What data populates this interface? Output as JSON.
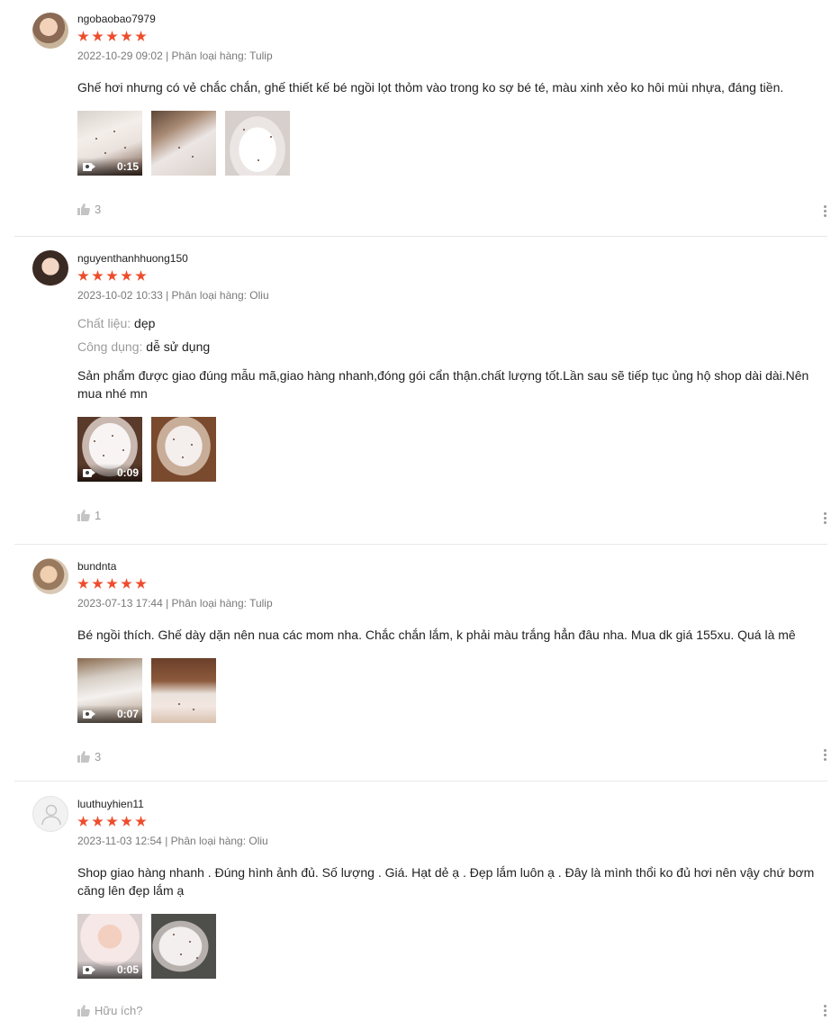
{
  "reviews": [
    {
      "username": "ngobaobao7979",
      "rating": 5,
      "date": "2022-10-29 09:02",
      "variant": "| Phân loại hàng: Tulip",
      "comment": "Ghế hơi nhưng có vẻ chắc chắn, ghế thiết kế bé ngồi lọt thỏm vào trong ko sợ bé té, màu xinh xẻo ko hôi mùi nhựa, đáng tiền.",
      "video_duration": "0:15",
      "likes": "3"
    },
    {
      "username": "nguyenthanhhuong150",
      "rating": 5,
      "date": "2023-10-02 10:33",
      "variant": "| Phân loại hàng: Oliu",
      "attr1_key": "Chất liệu: ",
      "attr1_val": "dẹp",
      "attr2_key": "Công dụng: ",
      "attr2_val": "dễ sử dụng",
      "comment": "Sản phẩm được giao đúng mẫu mã,giao hàng nhanh,đóng gói cẩn thận.chất lượng tốt.Lần sau sẽ tiếp tục ủng hộ shop dài dài.Nên mua nhé mn",
      "video_duration": "0:09",
      "likes": "1"
    },
    {
      "username": "bundnta",
      "rating": 5,
      "date": "2023-07-13 17:44",
      "variant": "| Phân loại hàng: Tulip",
      "comment": "Bé ngồi thích. Ghế dày dặn nên nua các mom nha. Chắc chắn lắm, k phải màu trắng hẳn đâu nha. Mua dk giá 155xu. Quá là mê",
      "video_duration": "0:07",
      "likes": "3"
    },
    {
      "username": "luuthuyhien11",
      "rating": 5,
      "date": "2023-11-03 12:54",
      "variant": "| Phân loại hàng: Oliu",
      "comment": "Shop giao hàng nhanh . Đúng hình ảnh đủ. Số lượng . Giá. Hạt dẻ ạ . Đẹp lắm luôn ạ .  Đây là mình thổi ko đủ hơi nên vậy chứ bơm căng lên đẹp lắm ạ",
      "video_duration": "0:05",
      "likes": "Hữu ích?"
    }
  ],
  "colors": {
    "star": "#ee4d2d",
    "muted": "#757575"
  },
  "icons": {
    "like": "thumbs-up-icon",
    "more": "more-vertical-icon",
    "video": "video-camera-icon",
    "avatar_default": "user-icon"
  }
}
